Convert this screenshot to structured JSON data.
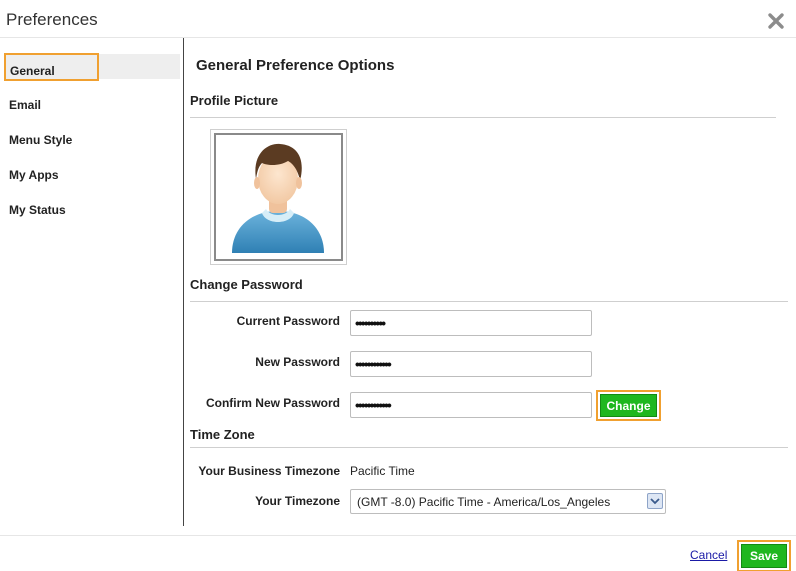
{
  "window": {
    "title": "Preferences",
    "close_icon": "close-icon"
  },
  "sidebar": {
    "items": [
      {
        "label": "General",
        "active": true
      },
      {
        "label": "Email",
        "active": false
      },
      {
        "label": "Menu Style",
        "active": false
      },
      {
        "label": "My Apps",
        "active": false
      },
      {
        "label": "My Status",
        "active": false
      }
    ]
  },
  "main": {
    "title": "General Preference Options",
    "profile": {
      "section_title": "Profile Picture",
      "avatar_icon": "user-avatar-icon"
    },
    "password": {
      "section_title": "Change Password",
      "current_label": "Current Password",
      "current_value": "••••••••••",
      "new_label": "New Password",
      "new_value": "••••••••••••",
      "confirm_label": "Confirm New Password",
      "confirm_value": "••••••••••••",
      "change_button": "Change"
    },
    "timezone": {
      "section_title": "Time Zone",
      "business_label": "Your Business Timezone",
      "business_value": "Pacific Time",
      "user_label": "Your Timezone",
      "user_value": "(GMT -8.0) Pacific Time - America/Los_Angeles"
    }
  },
  "footer": {
    "cancel_label": "Cancel",
    "save_label": "Save"
  },
  "colors": {
    "accent_highlight": "#f0a030",
    "button_green": "#1fb71f",
    "link_blue": "#1a1aa6"
  }
}
